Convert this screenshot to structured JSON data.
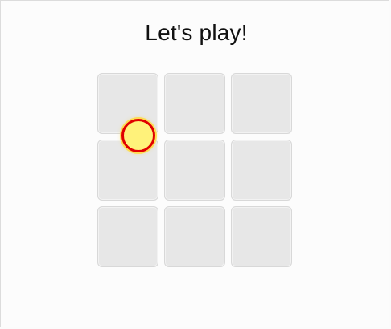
{
  "heading": {
    "title": "Let's play!"
  },
  "board": {
    "rows": 3,
    "columns": 3,
    "cells": [
      {
        "id": "r1c1",
        "value": ""
      },
      {
        "id": "r1c2",
        "value": ""
      },
      {
        "id": "r1c3",
        "value": ""
      },
      {
        "id": "r2c1",
        "value": ""
      },
      {
        "id": "r2c2",
        "value": ""
      },
      {
        "id": "r2c3",
        "value": ""
      },
      {
        "id": "r3c1",
        "value": ""
      },
      {
        "id": "r3c2",
        "value": ""
      },
      {
        "id": "r3c3",
        "value": ""
      }
    ]
  },
  "colors": {
    "background": "#fcfcfc",
    "cell_fill": "#e7e7e7",
    "cell_border": "#d8d8d8",
    "marker_fill": "#fff27a",
    "marker_outline": "#e00000",
    "marker_glow": "#ffdc46",
    "text": "#111111"
  },
  "icons": {
    "cursor_marker": "circle-cursor-icon"
  }
}
